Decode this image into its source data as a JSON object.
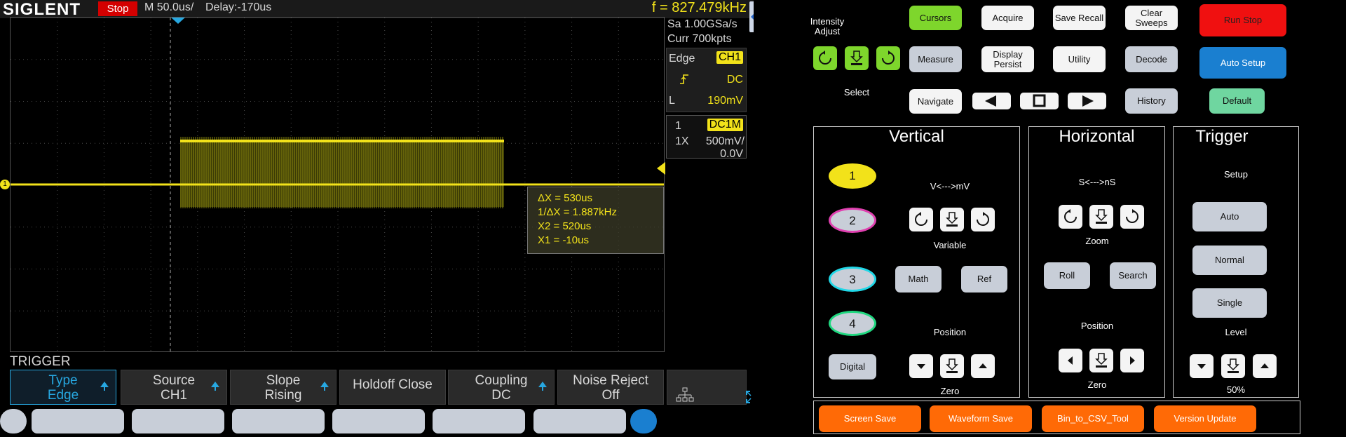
{
  "scope": {
    "brand": "SIGLENT",
    "run_state": "Stop",
    "timebase": "M 50.0us/",
    "delay": "Delay:-170us",
    "frequency": "f = 827.479kHz",
    "channel_marker": "1",
    "info": {
      "sample_rate": "Sa 1.00GSa/s",
      "memory": "Curr 700kpts",
      "trigger_type": "Edge",
      "trigger_source": "CH1",
      "trigger_coupling": "DC",
      "level_label": "L",
      "level_value": "190mV",
      "ch_number": "1",
      "ch_coupling": "DC1M",
      "probe": "1X",
      "volts_div": "500mV/",
      "offset": "0.0V"
    },
    "cursor_readout": {
      "dx": "ΔX = 530us",
      "inv_dx": "1/ΔX = 1.887kHz",
      "x2": "X2 = 520us",
      "x1": "X1 = -10us"
    },
    "menu": {
      "title": "TRIGGER",
      "softkeys": [
        {
          "line1": "Type",
          "line2": "Edge"
        },
        {
          "line1": "Source",
          "line2": "CH1"
        },
        {
          "line1": "Slope",
          "line2": "Rising"
        },
        {
          "line1": "Holdoff Close",
          "line2": ""
        },
        {
          "line1": "Coupling",
          "line2": "DC"
        },
        {
          "line1": "Noise Reject",
          "line2": "Off"
        }
      ]
    }
  },
  "panel": {
    "intensity_label": "Intensity Adjust",
    "select_label": "Select",
    "buttons": {
      "cursors": "Cursors",
      "acquire": "Acquire",
      "save_recall": "Save Recall",
      "clear_sweeps": "Clear Sweeps",
      "run_stop": "Run Stop",
      "measure": "Measure",
      "display_persist": "Display Persist",
      "utility": "Utility",
      "decode": "Decode",
      "auto_setup": "Auto Setup",
      "navigate": "Navigate",
      "history": "History",
      "default": "Default"
    },
    "vertical": {
      "title": "Vertical",
      "scale_label": "V<--->mV",
      "variable_label": "Variable",
      "position_label": "Position",
      "zero_label": "Zero",
      "channels": [
        "1",
        "2",
        "3",
        "4"
      ],
      "digital": "Digital",
      "math": "Math",
      "ref": "Ref"
    },
    "horizontal": {
      "title": "Horizontal",
      "scale_label": "S<--->nS",
      "zoom_label": "Zoom",
      "roll": "Roll",
      "search": "Search",
      "position_label": "Position",
      "zero_label": "Zero"
    },
    "trigger": {
      "title": "Trigger",
      "setup_label": "Setup",
      "auto": "Auto",
      "normal": "Normal",
      "single": "Single",
      "level_label": "Level",
      "fifty_label": "50%"
    },
    "tools": {
      "screen_save": "Screen Save",
      "waveform_save": "Waveform Save",
      "bin_to_csv": "Bin_to_CSV_Tool",
      "version_update": "Version Update"
    }
  }
}
